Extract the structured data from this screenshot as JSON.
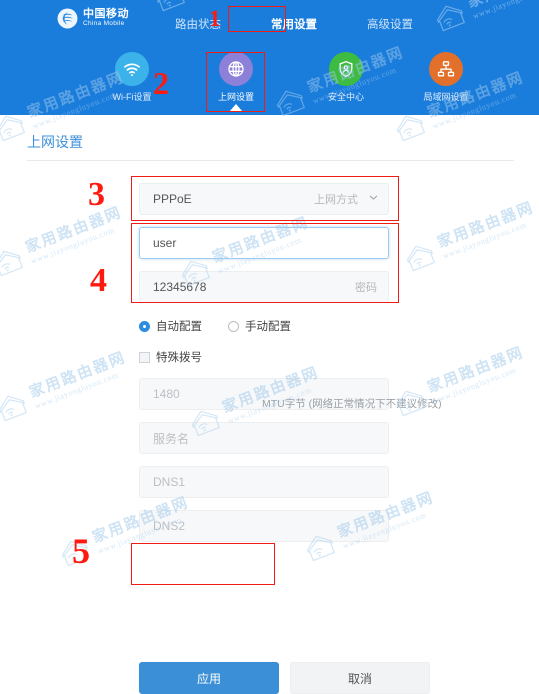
{
  "header": {
    "background_color": "#1a7ddc",
    "brand": {
      "cn": "中国移动",
      "en": "China Mobile",
      "logo_icon": "china-mobile-logo-icon"
    },
    "tabs": [
      {
        "label": "路由状态",
        "active": false
      },
      {
        "label": "常用设置",
        "active": true
      },
      {
        "label": "高级设置",
        "active": false
      }
    ],
    "icons": [
      {
        "label": "Wi-Fi设置",
        "icon": "wifi-icon",
        "color": "#3bb3ea",
        "active": false
      },
      {
        "label": "上网设置",
        "icon": "globe-icon",
        "color": "#8d80d8",
        "active": true
      },
      {
        "label": "安全中心",
        "icon": "shield-user-icon",
        "color": "#3ebb42",
        "active": false
      },
      {
        "label": "局域网设置",
        "icon": "network-topology-icon",
        "color": "#e2702a",
        "active": false
      }
    ]
  },
  "page": {
    "title": "上网设置",
    "title_color": "#3d8fdb"
  },
  "form": {
    "connection_type": {
      "value": "PPPoE",
      "label": "上网方式",
      "icon": "chevron-down-icon"
    },
    "username": {
      "value": "user",
      "label": "",
      "focused": true
    },
    "password": {
      "value": "12345678",
      "label": "密码"
    },
    "config_mode": {
      "options": [
        {
          "label": "自动配置",
          "selected": true
        },
        {
          "label": "手动配置",
          "selected": false
        }
      ]
    },
    "special_dial": {
      "label": "特殊拨号",
      "checked": false
    },
    "mtu": {
      "value": "1480",
      "hint": "MTU字节 (网络正常情况下不建议修改)"
    },
    "service_name": {
      "placeholder": "服务名",
      "value": ""
    },
    "dns1": {
      "placeholder": "DNS1",
      "value": ""
    },
    "dns2": {
      "placeholder": "DNS2",
      "value": ""
    }
  },
  "buttons": {
    "apply": "应用",
    "cancel": "取消"
  },
  "annotations": {
    "color": "#ff1a10",
    "markers": [
      {
        "number": "1"
      },
      {
        "number": "2"
      },
      {
        "number": "3"
      },
      {
        "number": "4"
      },
      {
        "number": "5"
      }
    ]
  },
  "watermark": {
    "cn": "家用路由器网",
    "en": "www.jiayongluyou.com",
    "icon": "house-wifi-watermark-icon"
  }
}
